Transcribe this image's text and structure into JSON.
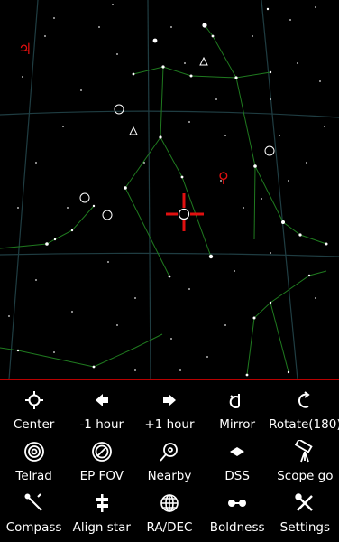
{
  "sky": {
    "planet_symbols": [
      {
        "name": "jupiter",
        "glyph": "♃",
        "color": "#e01010"
      },
      {
        "name": "venus",
        "glyph": "♀",
        "color": "#e01010"
      }
    ],
    "colors": {
      "background": "#000000",
      "grid_lines": "#1f3d42",
      "constellation_lines": "#1f7a1f",
      "reticle": "#e01010",
      "stars": "#ffffff",
      "deep_sky_markers": "#ffffff"
    }
  },
  "menu": {
    "colors": {
      "divider": "#b80000",
      "text": "#ffffff",
      "icon": "#ffffff"
    },
    "rows": [
      [
        {
          "label": "Center",
          "icon": "crosshair-circle-icon"
        },
        {
          "label": "-1 hour",
          "icon": "arrow-left-icon"
        },
        {
          "label": "+1 hour",
          "icon": "arrow-right-icon"
        },
        {
          "label": "Mirror",
          "icon": "mirror-icon"
        },
        {
          "label": "Rotate(180)",
          "icon": "rotate-icon"
        }
      ],
      [
        {
          "label": "Telrad",
          "icon": "telrad-icon"
        },
        {
          "label": "EP FOV",
          "icon": "eyepiece-fov-icon"
        },
        {
          "label": "Nearby",
          "icon": "nearby-icon"
        },
        {
          "label": "DSS",
          "icon": "dss-icon"
        },
        {
          "label": "Scope go",
          "icon": "telescope-icon"
        }
      ],
      [
        {
          "label": "Compass",
          "icon": "compass-icon"
        },
        {
          "label": "Align star",
          "icon": "align-star-icon"
        },
        {
          "label": "RA/DEC",
          "icon": "globe-grid-icon"
        },
        {
          "label": "Boldness",
          "icon": "boldness-icon"
        },
        {
          "label": "Settings",
          "icon": "settings-icon"
        }
      ]
    ]
  }
}
